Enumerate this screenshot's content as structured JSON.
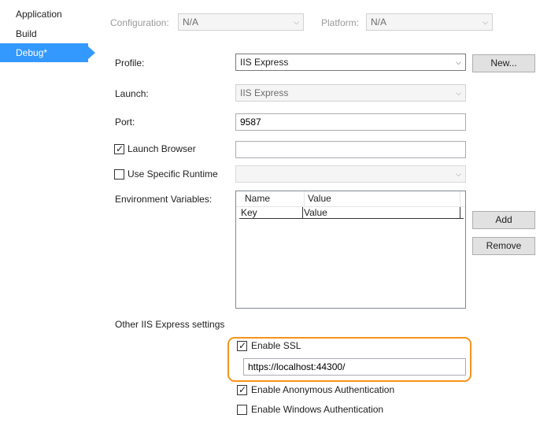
{
  "nav": {
    "items": [
      {
        "label": "Application"
      },
      {
        "label": "Build"
      },
      {
        "label": "Debug*"
      }
    ]
  },
  "config": {
    "configuration_label": "Configuration:",
    "configuration_value": "N/A",
    "platform_label": "Platform:",
    "platform_value": "N/A"
  },
  "form": {
    "profile_label": "Profile:",
    "profile_value": "IIS Express",
    "new_button": "New...",
    "launch_label": "Launch:",
    "launch_value": "IIS Express",
    "port_label": "Port:",
    "port_value": "9587",
    "launch_browser_label": "Launch Browser",
    "launch_browser_checked": true,
    "launch_browser_url": "",
    "specific_runtime_label": "Use Specific Runtime",
    "specific_runtime_checked": false,
    "env_label": "Environment Variables:",
    "env_columns": [
      "Name",
      "Value"
    ],
    "env_rows": [
      {
        "name": "Key",
        "value": "Value"
      }
    ],
    "add_button": "Add",
    "remove_button": "Remove",
    "iis_section_label": "Other IIS Express settings",
    "enable_ssl_label": "Enable SSL",
    "enable_ssl_checked": true,
    "ssl_url": "https://localhost:44300/",
    "anon_auth_label": "Enable Anonymous Authentication",
    "anon_auth_checked": true,
    "windows_auth_label": "Enable Windows Authentication",
    "windows_auth_checked": false
  },
  "colors": {
    "nav_active": "#3399ff",
    "highlight": "#f7931e"
  }
}
